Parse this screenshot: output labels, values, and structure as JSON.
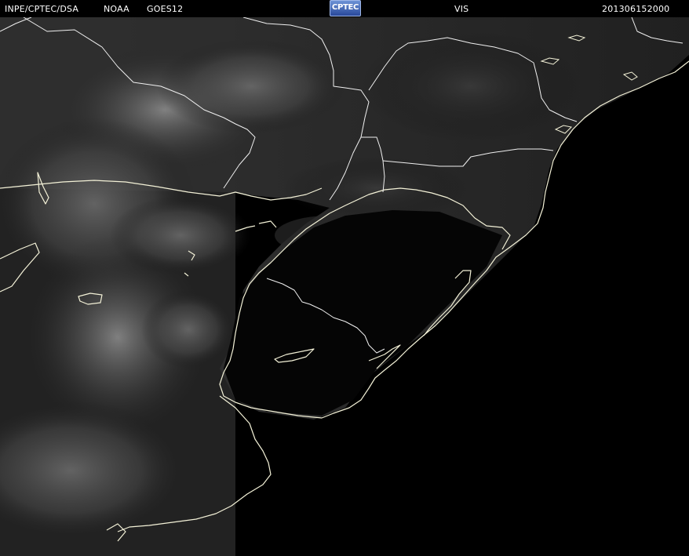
{
  "header": {
    "agency": "INPE/CPTEC/DSA",
    "source": "NOAA",
    "satellite": "GOES12",
    "logo_text": "CPTEC",
    "channel": "VIS",
    "timestamp": "201306152000"
  },
  "colors": {
    "background": "#000000",
    "header_text": "#ffffff",
    "coastline": "#f4f2d8",
    "border": "#f0f0f0",
    "logo": "#3a5fb5"
  }
}
